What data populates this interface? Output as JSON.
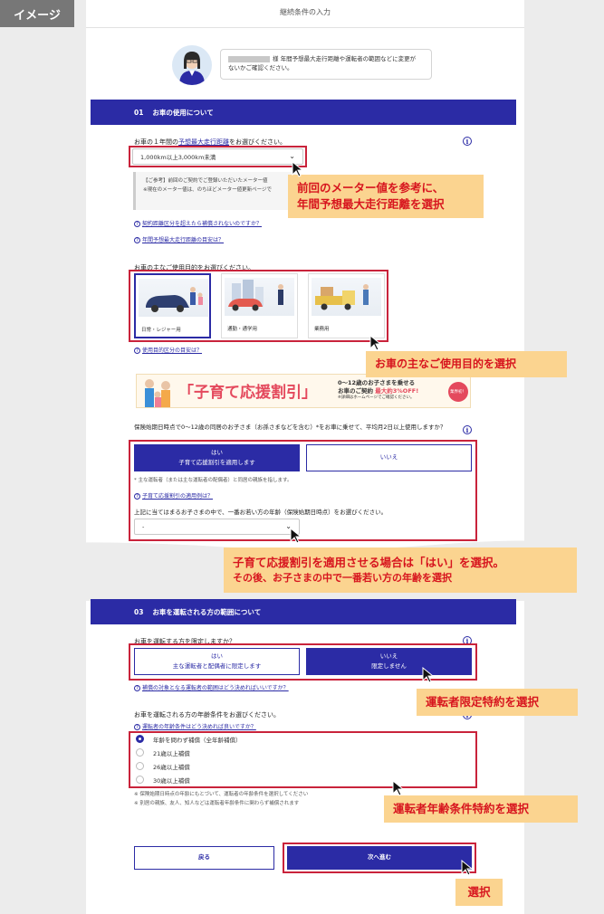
{
  "image_tag": "イメージ",
  "page_title": "継続条件の入力",
  "greeting": {
    "suffix": "様",
    "message_line1": "年間予想最大走行距離や運転者の範囲などに変更が",
    "message_line2": "ないかご確認ください。"
  },
  "section1": {
    "number": "01",
    "title": "お車の使用について",
    "mileage_question_prefix": "お車の１年間の",
    "mileage_question_link": "予想最大走行距離",
    "mileage_question_suffix": "をお選びください。",
    "mileage_value": "1,000km以上3,000km未満",
    "note_line1": "【ご参考】前回のご契約でご登録いただいたメーター値",
    "note_line2": "※現在のメーター値は、のちほどメーター値更新ページで",
    "link_over": "契約距離区分を超えたら補償されないのですか？",
    "link_guide": "年間予想最大走行距離の目安は？",
    "purpose_question": "お車の主なご使用目的をお選びください。",
    "purposes": [
      {
        "label": "日常・レジャー用"
      },
      {
        "label": "通勤・通学用"
      },
      {
        "label": "業務用"
      }
    ],
    "link_purpose": "使用目的区分の目安は？"
  },
  "banner": {
    "title": "「子育て応援割引」",
    "line1": "0〜12歳のお子さまを乗せる",
    "line2_prefix": "お車のご契約 ",
    "line2_em": "最大約3%OFF!",
    "line3": "※詳細はホームページでご確認ください。",
    "badge": "業界初！"
  },
  "child_discount": {
    "question": "保険始期日時点で0〜12歳の同居のお子さま（お孫さまなどを含む）*をお車に乗せて、平均月2日以上使用しますか？",
    "yes_line1": "はい",
    "yes_line2": "子育て応援割引を適用します",
    "no_label": "いいえ",
    "footnote": "* 主な運転者（または主な運転者の配偶者）と同居の親族を指します。",
    "link": "子育て応援割引の適用例は？",
    "age_question": "上記に当てはまるお子さまの中で、一番お若い方の年齢（保険始期日時点）をお選びください。",
    "age_value": "-"
  },
  "section3": {
    "number": "03",
    "title": "お車を運転される方の範囲について",
    "limit_question": "お車を運転する方を限定しますか？",
    "yes_line1": "はい",
    "yes_line2": "主な運転者と配偶者に限定します",
    "no_line1": "いいえ",
    "no_line2": "限定しません",
    "link_limit": "補償の対象となる運転者の範囲はどう決めればいいですか？",
    "age_question": "お車を運転される方の年齢条件をお選びください。",
    "age_link": "運転者の年齢条件はどう決めれば良いですか？",
    "age_options": [
      "年齢を問わず補償（全年齢補償）",
      "21歳以上補償",
      "26歳以上補償",
      "30歳以上補償"
    ],
    "note1": "※ 保険始期日時点の年齢にもとづいて、運転者の年齢条件を選択してください",
    "note2": "※ 別居の親族、友人、知人などは運転者年齢条件に関わらず補償されます"
  },
  "nav": {
    "back": "戻る",
    "next": "次へ進む"
  },
  "callouts": {
    "mileage_line1": "前回のメーター値を参考に、",
    "mileage_line2": "年間予想最大走行距離を選択",
    "purpose": "お車の主なご使用目的を選択",
    "child_line1": "子育て応援割引を適用させる場合は「はい」を選択。",
    "child_line2": "その後、お子さまの中で一番若い方の年齢を選択",
    "limit": "運転者限定特約を選択",
    "age": "運転者年齢条件特約を選択",
    "select": "選択"
  },
  "colors": {
    "primary": "#2b2ba5",
    "highlight": "#c9233b",
    "callout_bg": "#fbd490",
    "callout_text": "#d7151e"
  }
}
